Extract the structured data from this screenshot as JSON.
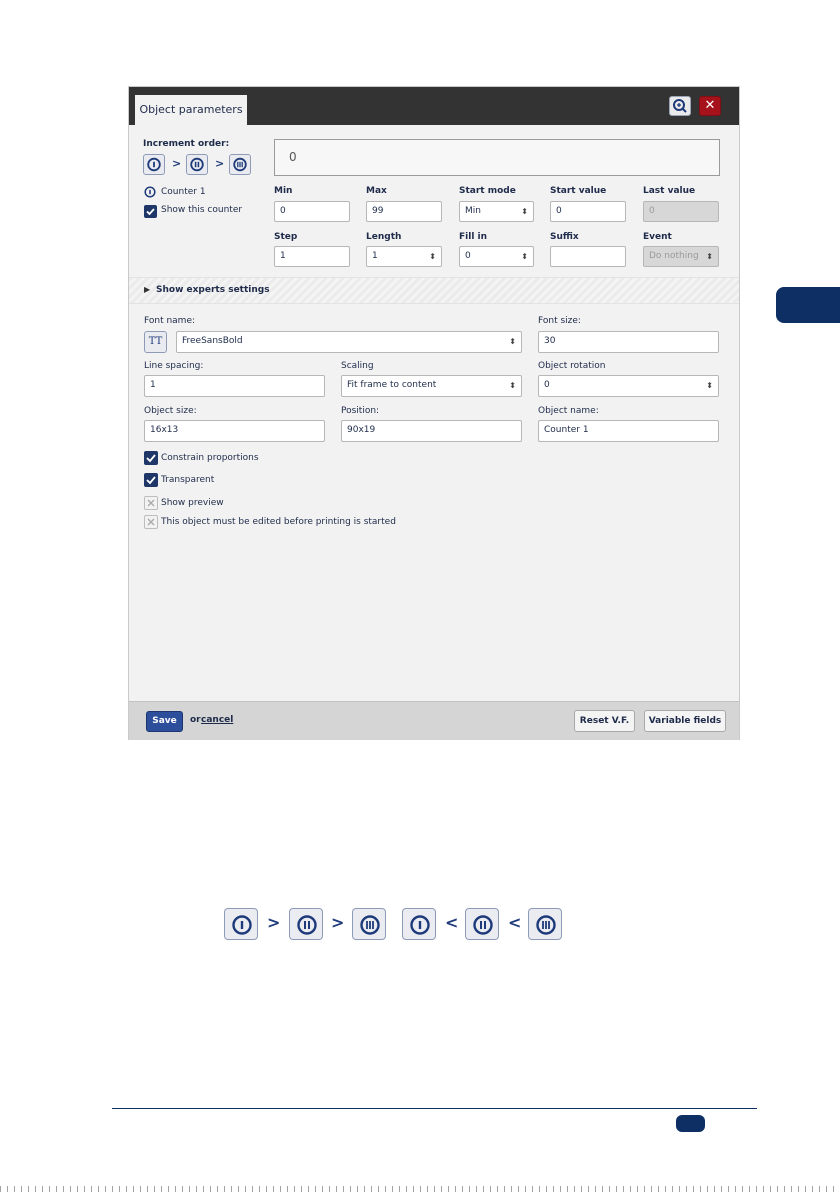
{
  "dialog": {
    "tab_title": "Object parameters",
    "preview_value": "0",
    "increment_order_label": "Increment order:",
    "order_separator": ">",
    "counter_label": "Counter 1",
    "show_counter_label": "Show this counter",
    "fields": {
      "min": {
        "label": "Min",
        "value": "0"
      },
      "max": {
        "label": "Max",
        "value": "99"
      },
      "start_mode": {
        "label": "Start mode",
        "value": "Min"
      },
      "start_value": {
        "label": "Start value",
        "value": "0"
      },
      "last_value": {
        "label": "Last value",
        "value": "0"
      },
      "step": {
        "label": "Step",
        "value": "1"
      },
      "length": {
        "label": "Length",
        "value": "1"
      },
      "fill_in": {
        "label": "Fill in",
        "value": "0"
      },
      "suffix": {
        "label": "Suffix",
        "value": ""
      },
      "event": {
        "label": "Event",
        "value": "Do nothing"
      }
    },
    "experts_label": "Show experts settings",
    "font_name": {
      "label": "Font name:",
      "value": "FreeSansBold",
      "icon_text": "TT"
    },
    "font_size": {
      "label": "Font size:",
      "value": "30"
    },
    "line_spacing": {
      "label": "Line spacing:",
      "value": "1"
    },
    "scaling": {
      "label": "Scaling",
      "value": "Fit frame to content"
    },
    "object_rotation": {
      "label": "Object rotation",
      "value": "0"
    },
    "object_size": {
      "label": "Object size:",
      "value": "16x13"
    },
    "position": {
      "label": "Position:",
      "value": "90x19"
    },
    "object_name": {
      "label": "Object name:",
      "value": "Counter 1"
    },
    "checks": {
      "constrain": {
        "label": "Constrain proportions",
        "checked": true
      },
      "transparent": {
        "label": "Transparent",
        "checked": true
      },
      "preview": {
        "label": "Show preview",
        "checked": false
      },
      "must_edit": {
        "label": "This object must be edited before printing is started",
        "checked": false
      }
    },
    "footer": {
      "save": "Save",
      "or": "or",
      "cancel": "cancel",
      "reset": "Reset V.F.",
      "variable_fields": "Variable fields"
    }
  },
  "illustration": {
    "gt": ">",
    "lt": "<"
  },
  "colors": {
    "navy": "#0d2f63",
    "titlebar": "#333333",
    "close_red": "#a5121b",
    "save_blue": "#2d4f9b",
    "check_navy": "#1f3768"
  }
}
